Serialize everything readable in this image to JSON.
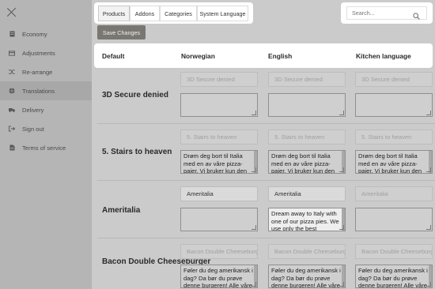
{
  "sidebar": {
    "items": [
      {
        "label": "Economy",
        "icon": "ledger-icon"
      },
      {
        "label": "Adjustments",
        "icon": "credit-card-icon"
      },
      {
        "label": "Re-arrange",
        "icon": "shuffle-icon"
      },
      {
        "label": "Translations",
        "icon": "globe-icon"
      },
      {
        "label": "Delivery",
        "icon": "truck-icon"
      },
      {
        "label": "Sign out",
        "icon": "sign-out-icon"
      },
      {
        "label": "Terms of service",
        "icon": "document-icon"
      }
    ]
  },
  "tabs": [
    "Products",
    "Addons",
    "Categories",
    "System Language"
  ],
  "search": {
    "placeholder": "Search..."
  },
  "save_label": "Save Changes",
  "columns": [
    "Default",
    "Norwegian",
    "English",
    "Kitchen language"
  ],
  "rows": [
    {
      "label": "3D Secure denied",
      "names": [
        "3D Secure denied",
        "3D Secure denied",
        "3D Secure denied"
      ],
      "descs": [
        "",
        "",
        ""
      ]
    },
    {
      "label": "5. Stairs to heaven",
      "names": [
        "5. Stairs to heaven",
        "5. Stairs to heaven",
        "5. Stairs to heaven"
      ],
      "descs": [
        "Drøm deg bort til Italia med en av våre pizza-paier. Vi bruker kun den",
        "Drøm deg bort til Italia med en av våre pizza-paier. Vi bruker kun den",
        "Drøm deg bort til Italia med en av våre pizza-paier. Vi bruker kun den"
      ]
    },
    {
      "label": "Ameritalia",
      "names": [
        "Ameritalia",
        "Ameritalia",
        "Ameritalia"
      ],
      "descs": [
        "",
        "Dream away to Italy with one of our pizza pies. We use only the best",
        ""
      ]
    },
    {
      "label": "Bacon Double Cheeseburger",
      "names": [
        "Bacon Double Cheeseburger",
        "Bacon Double Cheeseburger",
        "Bacon Double Cheeseburger"
      ],
      "descs": [
        "Føler du deg amerikansk i dag? Da bør du prøve denne burgeren! Alle våre",
        "Føler du deg amerikansk i dag? Da bør du prøve denne burgeren! Alle våre",
        "Føler du deg amerikansk i dag? Da bør du prøve denne burgeren! Alle våre"
      ]
    }
  ]
}
